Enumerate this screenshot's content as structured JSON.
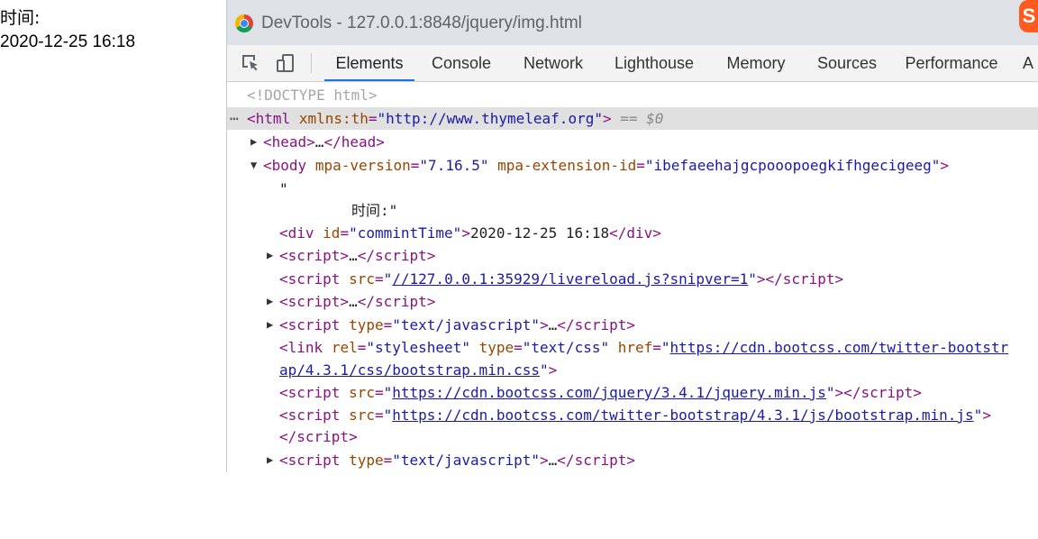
{
  "page": {
    "label": "时间:",
    "time": "2020-12-25 16:18"
  },
  "window": {
    "title": "DevTools - 127.0.0.1:8848/jquery/img.html",
    "ime_badge": "S"
  },
  "toolbar": {
    "tabs": [
      {
        "label": "Elements",
        "active": true
      },
      {
        "label": "Console"
      },
      {
        "label": "Network"
      },
      {
        "label": "Lighthouse"
      },
      {
        "label": "Memory"
      },
      {
        "label": "Sources"
      },
      {
        "label": "Performance"
      },
      {
        "label": "A"
      }
    ]
  },
  "dom": {
    "doctype": "<!DOCTYPE html>",
    "html_attr_name": "xmlns:th",
    "html_attr_value": "\"http://www.thymeleaf.org\"",
    "selected_marker": "== $0",
    "head_collapsed": "…",
    "body_attr1_name": "mpa-version",
    "body_attr1_value": "\"7.16.5\"",
    "body_attr2_name": "mpa-extension-id",
    "body_attr2_value": "\"ibefaeehajgcpooopoegkifhgecigeeg\"",
    "text_quote": "\"",
    "text_content": "时间:\"",
    "div_attr_name": "id",
    "div_attr_value": "\"commintTime\"",
    "div_text": "2020-12-25 16:18",
    "script_collapsed": "…",
    "livereload_src": "//127.0.0.1:35929/livereload.js?snipver=1",
    "script_type_value": "\"text/javascript\"",
    "link_rel_value": "\"stylesheet\"",
    "link_type_value": "\"text/css\"",
    "bootstrap_css_part1": "https://cdn.bootcss.com/twitter-bootstr",
    "bootstrap_css_part2": "ap/4.3.1/css/bootstrap.min.css",
    "jquery_src": "https://cdn.bootcss.com/jquery/3.4.1/jquery.min.js",
    "bootstrap_js_src": "https://cdn.bootcss.com/twitter-bootstrap/4.3.1/js/bootstrap.min.js"
  },
  "colors": {
    "tag": "#881280",
    "attr_name": "#994500",
    "attr_value": "#1a1aa6",
    "active_tab_underline": "#1a73e8",
    "selected_row": "#e0e0e0"
  }
}
